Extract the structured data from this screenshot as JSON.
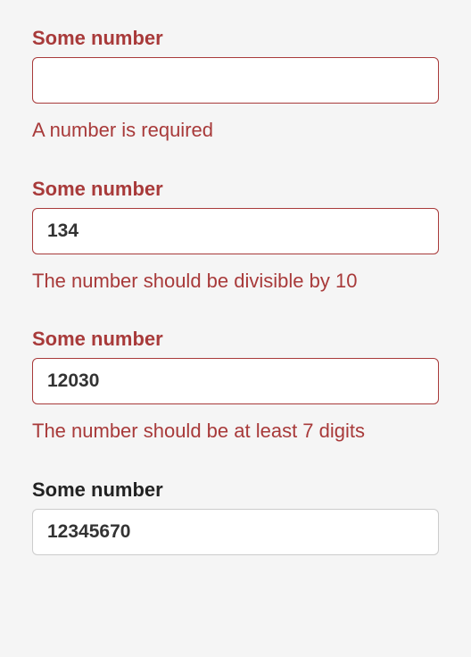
{
  "fields": [
    {
      "label": "Some number",
      "value": "",
      "message": "A number is required",
      "state": "error"
    },
    {
      "label": "Some number",
      "value": "134",
      "message": "The number should be divisible by 10",
      "state": "error"
    },
    {
      "label": "Some number",
      "value": "12030",
      "message": "The number should be at least 7 digits",
      "state": "error"
    },
    {
      "label": "Some number",
      "value": "12345670",
      "message": "",
      "state": "valid"
    }
  ]
}
